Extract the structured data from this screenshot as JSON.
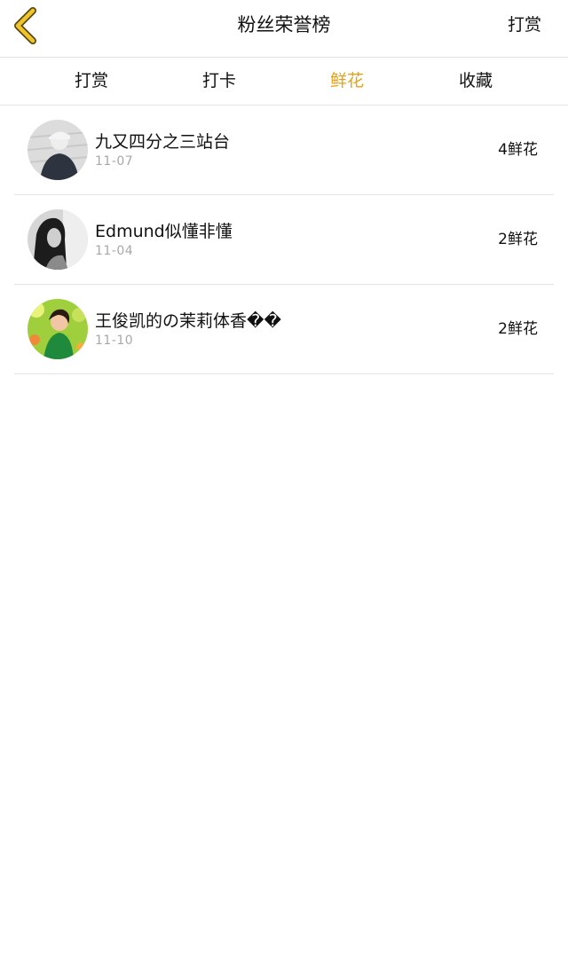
{
  "header": {
    "title": "粉丝荣誉榜",
    "right_action": "打赏",
    "back_icon": "chevron-left-icon",
    "back_icon_color": "#f0c52c"
  },
  "tabs": [
    {
      "label": "打赏",
      "active": false
    },
    {
      "label": "打卡",
      "active": false
    },
    {
      "label": "鲜花",
      "active": true
    },
    {
      "label": "收藏",
      "active": false
    }
  ],
  "active_tab_color": "#e7a117",
  "fans": [
    {
      "name": "九又四分之三站台",
      "date": "11-07",
      "count": "4鲜花"
    },
    {
      "name": "Edmund似懂非懂",
      "date": "11-04",
      "count": "2鲜花"
    },
    {
      "name": "王俊凯的の茉莉体香��",
      "date": "11-10",
      "count": "2鲜花"
    }
  ]
}
